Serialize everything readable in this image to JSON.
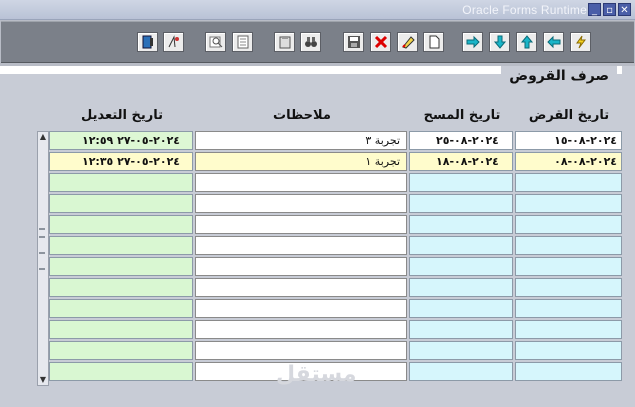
{
  "window": {
    "title": "Oracle Forms Runtime",
    "buttons": [
      "_",
      "▫",
      "✕"
    ]
  },
  "toolbar": {
    "buttons": [
      {
        "name": "exit-icon"
      },
      {
        "name": "help-query-icon"
      },
      {
        "name": "enter-query-icon"
      },
      {
        "name": "execute-query-icon"
      },
      {
        "name": "clipboard-icon"
      },
      {
        "name": "binoculars-icon"
      },
      {
        "name": "save-icon"
      },
      {
        "name": "delete-record-icon"
      },
      {
        "name": "edit-record-icon"
      },
      {
        "name": "new-record-icon"
      },
      {
        "name": "next-record-icon"
      },
      {
        "name": "down-arrow-icon"
      },
      {
        "name": "up-arrow-icon"
      },
      {
        "name": "previous-record-icon"
      },
      {
        "name": "lightning-icon"
      }
    ]
  },
  "form": {
    "title": "صرف القروض",
    "columns": {
      "loan_date": "تاريخ القرض",
      "scan_date": "تاريخ المسح",
      "notes": "ملاحظات",
      "modified_date": "تاريخ التعديل"
    },
    "rows": [
      {
        "loan_date": "٢٠٢٤-٠٨-١٥",
        "scan_date": "٢٠٢٤-٠٨-٢٥",
        "notes": "تجربة ٣",
        "modified_date": "٢٠٢٤-٠٥-٢٧     ١٢:٥٩"
      },
      {
        "loan_date": "٢٠٢٤-٠٨-٠٨",
        "scan_date": "٢٠٢٤-٠٨-١٨",
        "notes": "تجربة ١",
        "modified_date": "٢٠٢٤-٠٥-٢٧     ١٢:٣٥"
      }
    ],
    "empty_rows": 10
  },
  "watermark": "مستقل"
}
